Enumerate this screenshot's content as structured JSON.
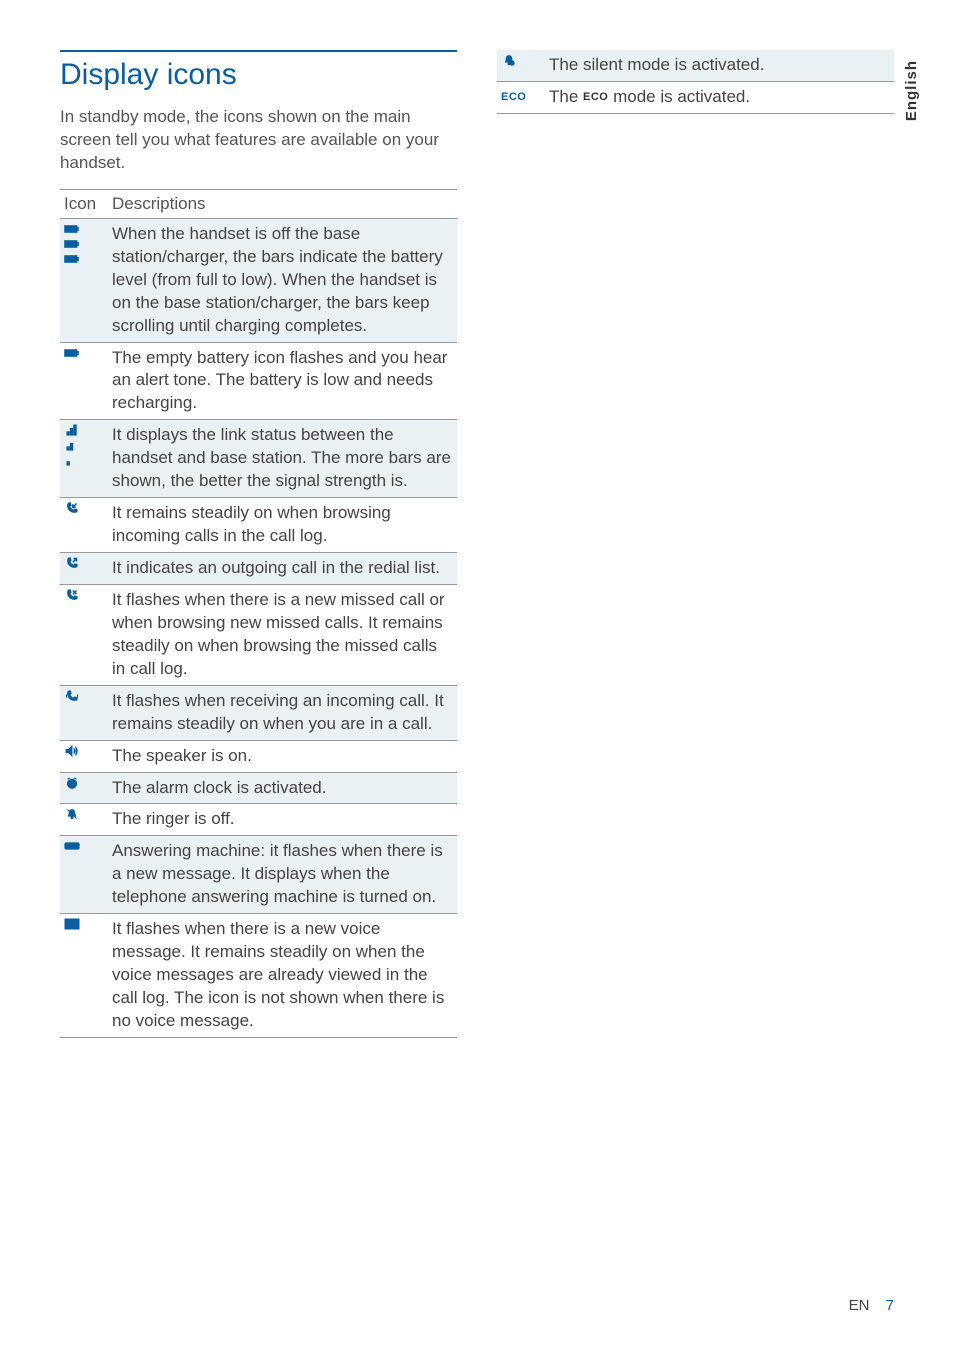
{
  "side_tab": "English",
  "section_title": "Display icons",
  "intro": "In standby mode, the icons shown on the main screen tell you what features are available on your handset.",
  "table_header": {
    "icon": "Icon",
    "desc": "Descriptions"
  },
  "rows": [
    {
      "icon_name": "battery-levels-icon",
      "desc": "When the handset is off the base station/charger, the bars indicate the battery level (from full to low).\nWhen the handset is on the base station/charger, the bars keep scrolling until charging completes."
    },
    {
      "icon_name": "battery-empty-icon",
      "desc": "The empty battery icon flashes and you hear an alert tone.\nThe battery is low and needs recharging."
    },
    {
      "icon_name": "signal-bars-icon",
      "desc": "It displays the link status between the handset and base station. The more bars are shown, the better the signal strength is."
    },
    {
      "icon_name": "incoming-call-icon",
      "desc": "It remains steadily on when browsing incoming calls in the call log."
    },
    {
      "icon_name": "outgoing-call-icon",
      "desc": "It indicates an outgoing call in the redial list."
    },
    {
      "icon_name": "missed-call-icon",
      "desc": "It flashes when there is a new missed call or when browsing new missed calls.\nIt remains steadily on when browsing the missed calls in call log."
    },
    {
      "icon_name": "in-call-icon",
      "desc": "It flashes when receiving an incoming call. It remains steadily on when you are in a call."
    },
    {
      "icon_name": "speaker-icon",
      "desc": "The speaker is on."
    },
    {
      "icon_name": "alarm-clock-icon",
      "desc": "The alarm clock is activated."
    },
    {
      "icon_name": "ringer-off-icon",
      "desc": "The ringer is off."
    },
    {
      "icon_name": "answering-machine-icon",
      "desc": "Answering machine: it flashes when there is a new message. It displays when the telephone answering machine is turned on."
    },
    {
      "icon_name": "voicemail-icon",
      "desc": "It flashes when there is a new voice message.\nIt remains steadily on when the voice messages are already viewed in the call log.\nThe icon is not shown when there is no voice message."
    }
  ],
  "rows2": [
    {
      "icon_name": "silent-mode-icon",
      "desc": "The silent mode is activated."
    },
    {
      "icon_name": "eco-mode-icon",
      "desc_pre": "The ",
      "desc_post": " mode is activated.",
      "eco_label": "ECO"
    }
  ],
  "footer": {
    "lang": "EN",
    "page": "7"
  }
}
